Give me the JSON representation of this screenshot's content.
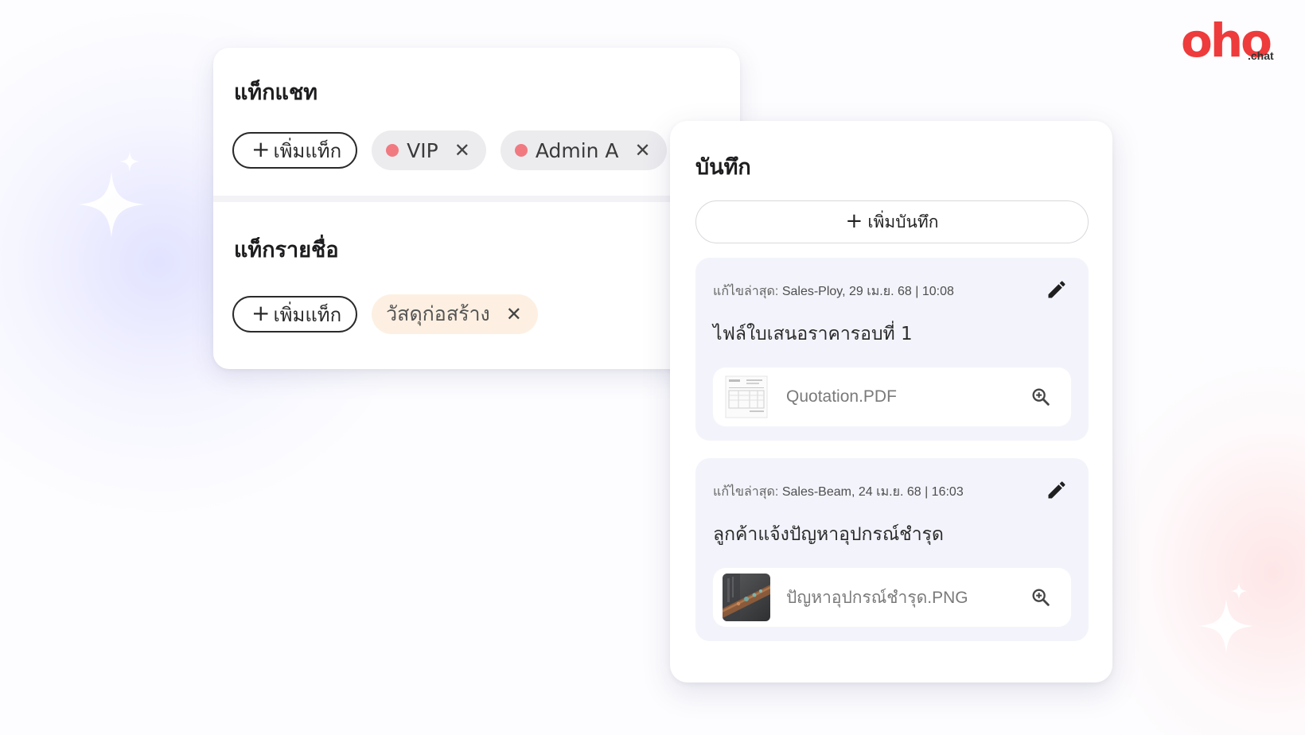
{
  "brand": {
    "logo_text": "oho",
    "logo_sub": ".chat",
    "accent_color": "#ee3b3b"
  },
  "tags_card": {
    "chat_tags": {
      "title": "แท็กแชท",
      "add_label": "เพิ่มแท็ก",
      "tags": [
        {
          "label": "VIP",
          "dot_color": "#f07a80"
        },
        {
          "label": "Admin A",
          "dot_color": "#f07a80"
        }
      ]
    },
    "contact_tags": {
      "title": "แท็กรายชื่อ",
      "add_label": "เพิ่มแท็ก",
      "tags": [
        {
          "label": "วัสดุก่อสร้าง",
          "background": "#fdf0e2"
        }
      ]
    },
    "icons": {
      "add": "plus-icon",
      "remove": "close-icon"
    }
  },
  "notes_card": {
    "title": "บันทึก",
    "add_note_label": "เพิ่มบันทึก",
    "notes": [
      {
        "meta_label": "แก้ไขล่าสุด:",
        "meta_value": "Sales-Ploy, 29 เม.ย. 68 | 10:08",
        "text": "ไฟล์ใบเสนอราคารอบที่ 1",
        "attachment": {
          "file_name": "Quotation.PDF",
          "thumbnail": "document-thumbnail"
        }
      },
      {
        "meta_label": "แก้ไขล่าสุด:",
        "meta_value": "Sales-Beam, 24 เม.ย. 68 | 16:03",
        "text": "ลูกค้าแจ้งปัญหาอุปกรณ์ชำรุด",
        "attachment": {
          "file_name": "ปัญหาอุปกรณ์ชำรุด.PNG",
          "thumbnail": "rusty-pipe-photo-thumbnail"
        }
      }
    ],
    "icons": {
      "edit": "pencil-icon",
      "preview": "zoom-in-icon"
    }
  }
}
